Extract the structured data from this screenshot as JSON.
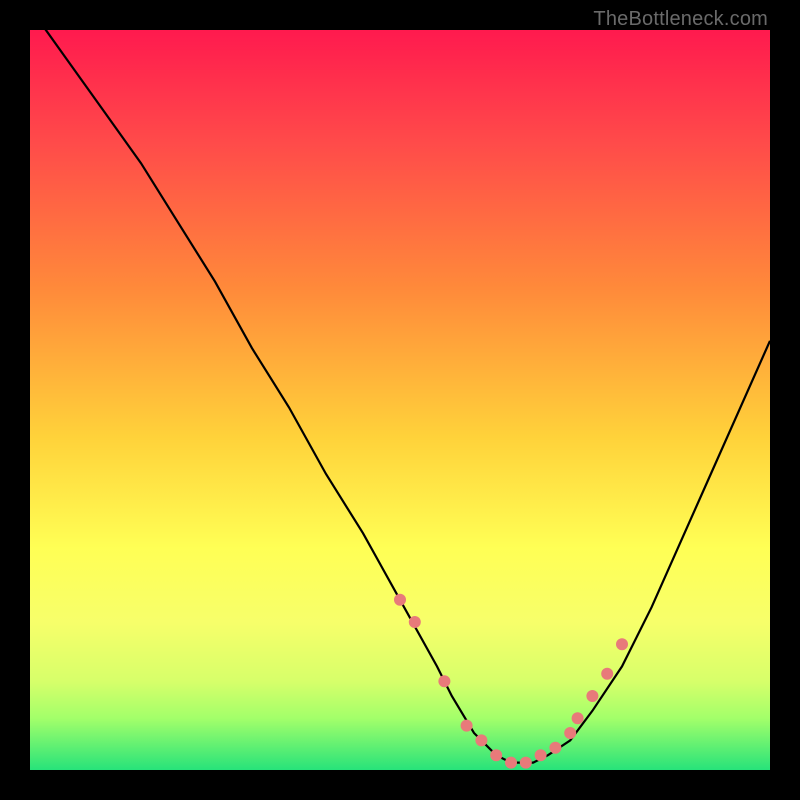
{
  "watermark": "TheBottleneck.com",
  "chart_data": {
    "type": "line",
    "title": "",
    "xlabel": "",
    "ylabel": "",
    "xlim": [
      0,
      100
    ],
    "ylim": [
      0,
      100
    ],
    "series": [
      {
        "name": "bottleneck-curve",
        "x": [
          0,
          5,
          10,
          15,
          20,
          25,
          30,
          35,
          40,
          45,
          50,
          55,
          57,
          60,
          63,
          65,
          68,
          70,
          73,
          76,
          80,
          84,
          88,
          92,
          96,
          100
        ],
        "y": [
          103,
          96,
          89,
          82,
          74,
          66,
          57,
          49,
          40,
          32,
          23,
          14,
          10,
          5,
          2,
          1,
          1,
          2,
          4,
          8,
          14,
          22,
          31,
          40,
          49,
          58
        ]
      }
    ],
    "markers": {
      "name": "highlighted-points",
      "color": "#e87a7a",
      "radius_px": 6,
      "x": [
        50,
        52,
        56,
        59,
        61,
        63,
        65,
        67,
        69,
        71,
        73,
        74,
        76,
        78,
        80
      ],
      "y": [
        23,
        20,
        12,
        6,
        4,
        2,
        1,
        1,
        2,
        3,
        5,
        7,
        10,
        13,
        17
      ]
    }
  }
}
